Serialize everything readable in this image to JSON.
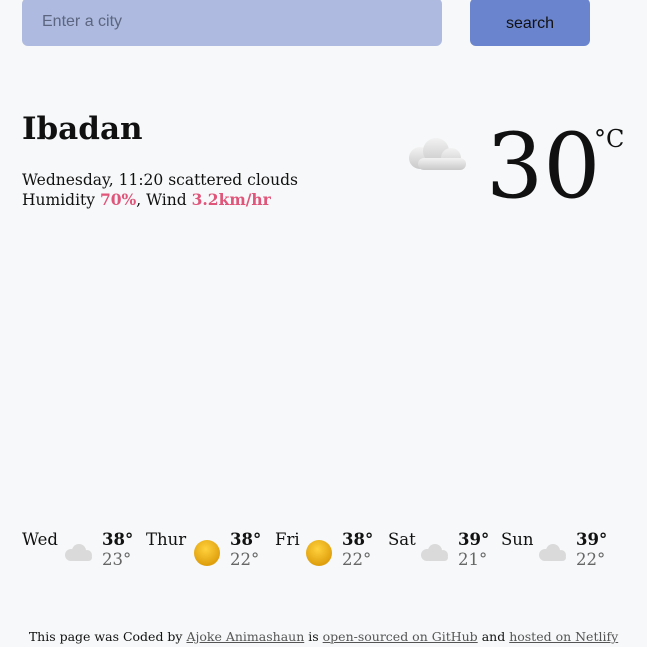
{
  "search": {
    "placeholder": "Enter a city",
    "button_label": "search"
  },
  "current": {
    "city": "Ibadan",
    "day": "Wednesday",
    "time": "11:20",
    "description": "scattered clouds",
    "humidity_label": "Humidity",
    "humidity": "70%",
    "wind_label": "Wind",
    "wind": "3.2km/hr",
    "temperature": "30",
    "unit": "°C",
    "icon": "cloud-icon"
  },
  "forecast": [
    {
      "day": "Wed",
      "max": "38°",
      "min": "23°",
      "icon": "cloud-icon"
    },
    {
      "day": "Thur",
      "max": "38°",
      "min": "22°",
      "icon": "sun-icon"
    },
    {
      "day": "Fri",
      "max": "38°",
      "min": "22°",
      "icon": "sun-icon"
    },
    {
      "day": "Sat",
      "max": "39°",
      "min": "21°",
      "icon": "cloud-icon"
    },
    {
      "day": "Sun",
      "max": "39°",
      "min": "22°",
      "icon": "cloud-icon"
    }
  ],
  "footer": {
    "prefix": "This page was Coded by",
    "author": "Ajoke Animashaun",
    "is": "is",
    "github": "open-sourced on GitHub",
    "and": "and",
    "netlify": "hosted on Netlify"
  },
  "colors": {
    "accent": "#e0557a",
    "search_bg": "#aebadf",
    "button_bg": "#6a84cd",
    "page_bg": "#f6f8f9"
  }
}
